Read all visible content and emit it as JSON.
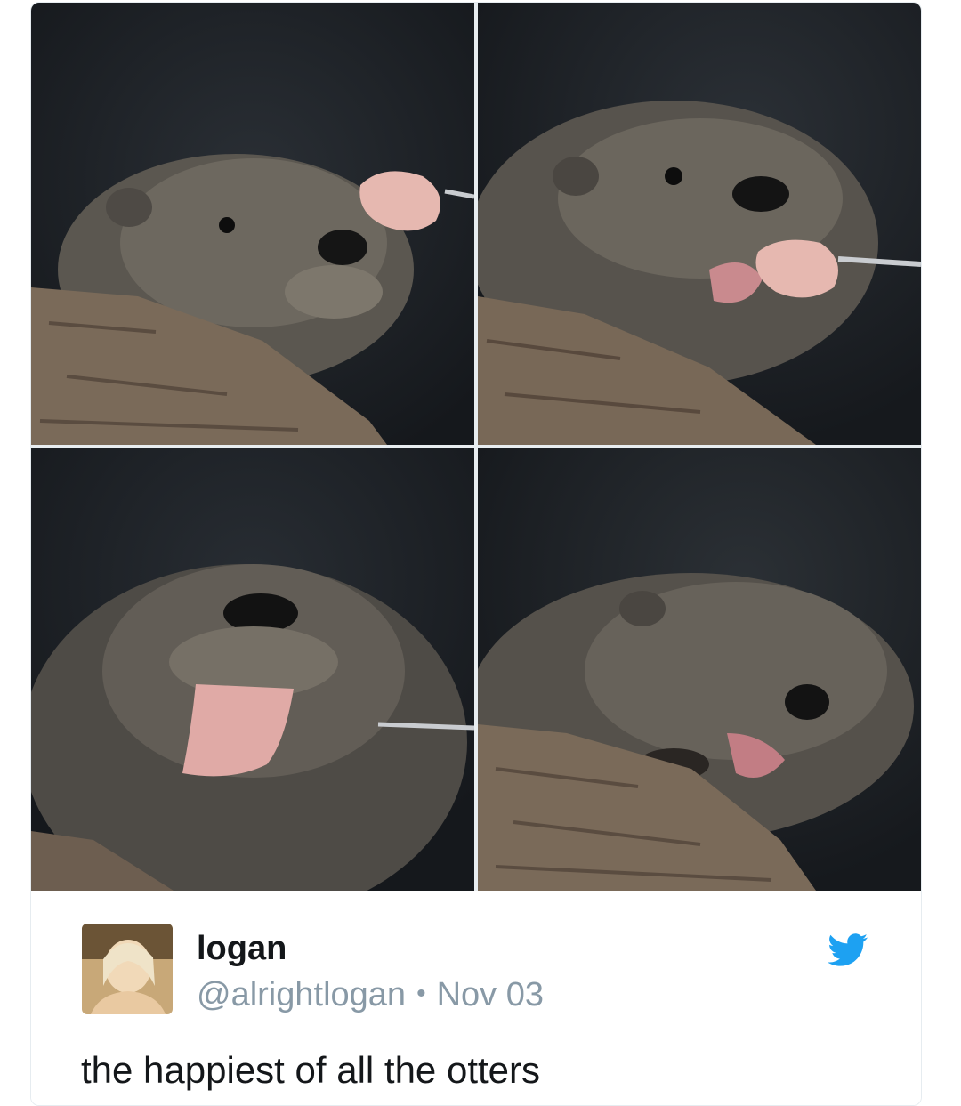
{
  "media": {
    "photos": [
      {
        "alt": "otter looking at meat on a skewer"
      },
      {
        "alt": "otter biting meat on a skewer"
      },
      {
        "alt": "otter licking with tongue out"
      },
      {
        "alt": "otter smiling with mouth open"
      }
    ]
  },
  "tweet": {
    "display_name": "logan",
    "handle": "@alrightlogan",
    "separator": "•",
    "date": "Nov 03",
    "text": "the happiest of all the otters",
    "icon": "twitter-bird-icon",
    "brand_color": "#1da1f2"
  }
}
